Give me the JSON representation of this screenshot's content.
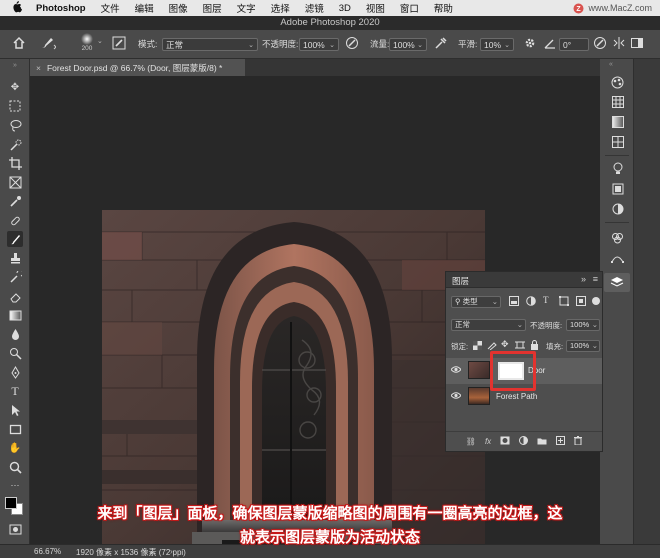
{
  "menubar": {
    "app_name": "Photoshop",
    "items": [
      "文件",
      "编辑",
      "图像",
      "图层",
      "文字",
      "选择",
      "滤镜",
      "3D",
      "视图",
      "窗口",
      "帮助"
    ],
    "watermark": "www.MacZ.com"
  },
  "window": {
    "title": "Adobe Photoshop 2020"
  },
  "options": {
    "brush_size": "200",
    "mode_label": "模式:",
    "mode_value": "正常",
    "opacity_label": "不透明度:",
    "opacity_value": "100%",
    "flow_label": "流量:",
    "flow_value": "100%",
    "smooth_label": "平滑:",
    "smooth_value": "10%",
    "angle_value": "0°"
  },
  "document": {
    "tab_title": "Forest Door.psd @ 66.7% (Door, 图层蒙版/8) *"
  },
  "layers_panel": {
    "title": "图层",
    "filter_kind": "类型",
    "blend_mode": "正常",
    "opacity_label": "不透明度:",
    "opacity_value": "100%",
    "lock_label": "锁定:",
    "fill_label": "填充:",
    "fill_value": "100%",
    "layers": [
      {
        "name": "Door",
        "selected": true,
        "has_mask": true
      },
      {
        "name": "Forest Path",
        "selected": false,
        "has_mask": false
      }
    ],
    "footer_fx": "fx"
  },
  "status": {
    "zoom": "66.67%",
    "doc_info": "1920 像素 x 1536 像素 (72 ppi)"
  },
  "caption": {
    "line1": "来到「图层」面板，确保图层蒙版缩略图的周围有一圈高亮的边框，这",
    "line2": "就表示图层蒙版为活动状态"
  },
  "colors": {
    "highlight": "#e2332f",
    "panel_bg": "#4e4e4e",
    "canvas_bg": "#282828"
  }
}
